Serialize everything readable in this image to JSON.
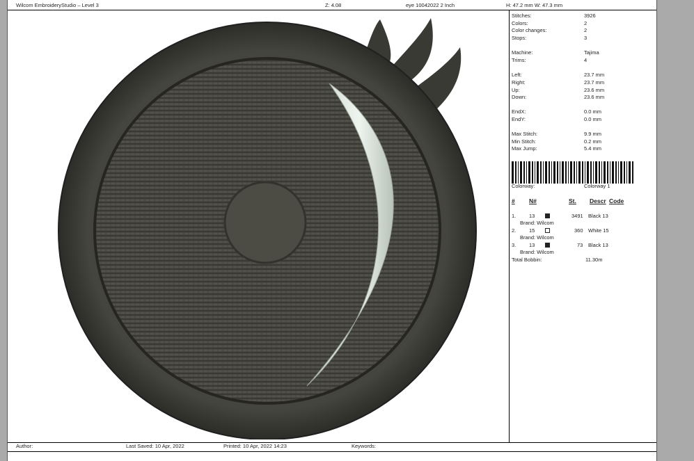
{
  "header": {
    "app": "Wilcom EmbroideryStudio – Level 3",
    "zoom": "Z: 4.08",
    "design": "eye 10042022 2 Inch",
    "size": "H: 47.2 mm W: 47.3 mm"
  },
  "stats": [
    {
      "k": "Stitches:",
      "v": "3926"
    },
    {
      "k": "Colors:",
      "v": "2"
    },
    {
      "k": "Color changes:",
      "v": "2"
    },
    {
      "k": "Stops:",
      "v": "3"
    },
    {
      "k": "Machine:",
      "v": "Tajima"
    },
    {
      "k": "Trims:",
      "v": "4"
    },
    {
      "k": "Left:",
      "v": "23.7 mm"
    },
    {
      "k": "Right:",
      "v": "23.7 mm"
    },
    {
      "k": "Up:",
      "v": "23.6 mm"
    },
    {
      "k": "Down:",
      "v": "23.6 mm"
    },
    {
      "k": "EndX:",
      "v": "0.0 mm"
    },
    {
      "k": "EndY:",
      "v": "0.0 mm"
    },
    {
      "k": "Max Stitch:",
      "v": "9.9 mm"
    },
    {
      "k": "Min Stitch:",
      "v": "0.2 mm"
    },
    {
      "k": "Max Jump:",
      "v": "5.4 mm"
    }
  ],
  "colorway": {
    "k": "Colorway:",
    "v": "Colorway 1"
  },
  "table": {
    "headers": [
      "#",
      "N#",
      "St.",
      "Descr",
      "Code"
    ],
    "rows": [
      {
        "idx": "1.",
        "n": "13",
        "swatch": "#222222",
        "st": "3491",
        "descr": "Black 13",
        "brand": "Brand: Wilcom"
      },
      {
        "idx": "2.",
        "n": "15",
        "swatch": "#ffffff",
        "st": "360",
        "descr": "White 15",
        "brand": "Brand: Wilcom"
      },
      {
        "idx": "3.",
        "n": "13",
        "swatch": "#222222",
        "st": "73",
        "descr": "Black 13",
        "brand": "Brand: Wilcom"
      }
    ],
    "bobbin_label": "Total Bobbin:",
    "bobbin_value": "11.30m"
  },
  "footer": {
    "author": "Author:",
    "last_saved": "Last Saved: 10 Apr, 2022",
    "printed": "Printed: 10 Apr, 2022 14:23",
    "keywords": "Keywords:"
  }
}
